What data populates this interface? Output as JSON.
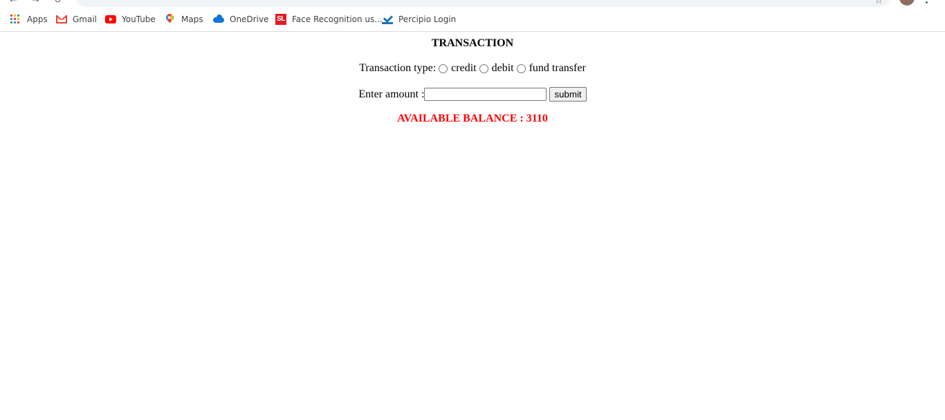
{
  "bookmarks": [
    {
      "label": "Apps",
      "icon": "apps-grid-icon"
    },
    {
      "label": "Gmail",
      "icon": "gmail-icon"
    },
    {
      "label": "YouTube",
      "icon": "youtube-icon"
    },
    {
      "label": "Maps",
      "icon": "maps-icon"
    },
    {
      "label": "OneDrive",
      "icon": "onedrive-icon"
    },
    {
      "label": "Face Recognition us...",
      "icon": "sl-icon",
      "icon_text": "SL"
    },
    {
      "label": "Percipio Login",
      "icon": "percipio-icon"
    }
  ],
  "page": {
    "title": "TRANSACTION",
    "transaction_type_label": "Transaction type:",
    "options": [
      {
        "label": "credit",
        "checked": false
      },
      {
        "label": "debit",
        "checked": false
      },
      {
        "label": "fund transfer",
        "checked": false
      }
    ],
    "amount_label": "Enter amount :",
    "amount_value": "",
    "submit_label": "submit",
    "balance_text": "AVAILABLE BALANCE : 3110"
  },
  "colors": {
    "balance": "#ff0000",
    "youtube": "#ff0000",
    "gmail": "#ea4335",
    "onedrive": "#0f78d4",
    "sl_badge": "#e31b23",
    "percipio": "#1a73b8"
  }
}
